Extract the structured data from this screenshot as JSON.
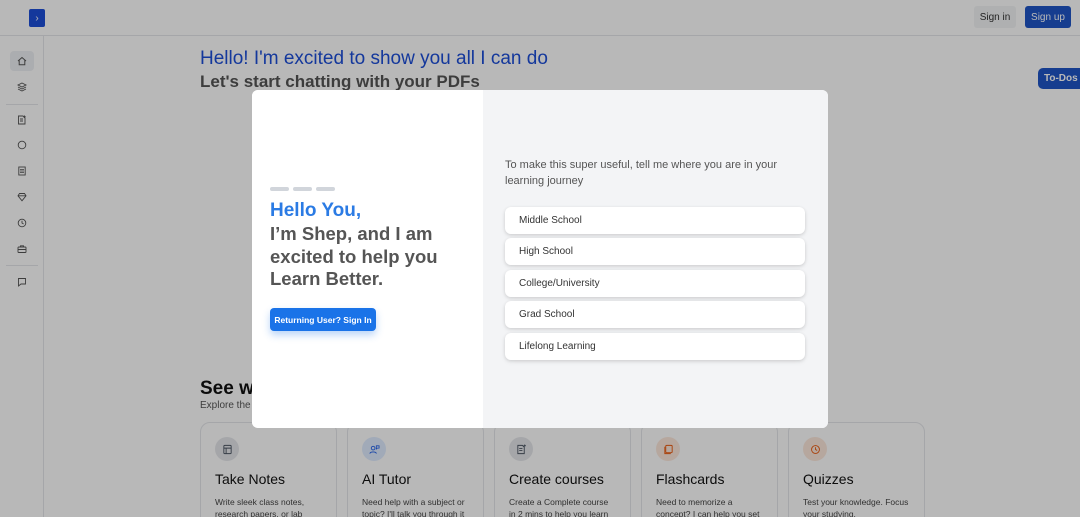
{
  "header": {
    "toggle_glyph": "›",
    "sign_in": "Sign in",
    "sign_up": "Sign up"
  },
  "sidebar": {
    "icons": [
      "home-icon",
      "layers-icon",
      "note-add-icon",
      "chat-icon",
      "document-icon",
      "diamond-icon",
      "clock-icon",
      "briefcase-icon",
      "feedback-icon"
    ]
  },
  "hero": {
    "title": "Hello! I'm excited to show you all I can do",
    "subtitle": "Let's start chatting with your PDFs"
  },
  "todos_label": "To-Dos",
  "features_section": {
    "title": "See wh",
    "subtitle": "Explore the f"
  },
  "features": [
    {
      "icon": "notes-icon",
      "title": "Take Notes",
      "desc": "Write sleek class notes, research papers, or lab",
      "color": "#e5e7eb",
      "icon_color": "#4b5563"
    },
    {
      "icon": "tutor-icon",
      "title": "AI Tutor",
      "desc": "Need help with a subject or topic? I'll talk you through it",
      "color": "#e0ecff",
      "icon_color": "#2563eb"
    },
    {
      "icon": "course-icon",
      "title": "Create courses",
      "desc": "Create a Complete course in 2 mins to help you learn",
      "color": "#e5e7eb",
      "icon_color": "#4b5563"
    },
    {
      "icon": "flashcard-icon",
      "title": "Flashcards",
      "desc": "Need to memorize a concept? I can help you set",
      "color": "#fde8dc",
      "icon_color": "#ea580c"
    },
    {
      "icon": "quiz-icon",
      "title": "Quizzes",
      "desc": "Test your knowledge. Focus your studying.",
      "color": "#fde8dc",
      "icon_color": "#ea580c"
    }
  ],
  "modal": {
    "greeting": "Hello You,",
    "intro": "I’m Shep, and I am excited to help you Learn Better.",
    "returning_button": "Returning User? Sign In",
    "question": "To make this super useful, tell me where you are in your learning journey",
    "options": [
      "Middle School",
      "High School",
      "College/University",
      "Grad School",
      "Lifelong Learning"
    ]
  },
  "colors": {
    "brand_blue": "#1f55c7",
    "accent_blue": "#2b7be4"
  }
}
